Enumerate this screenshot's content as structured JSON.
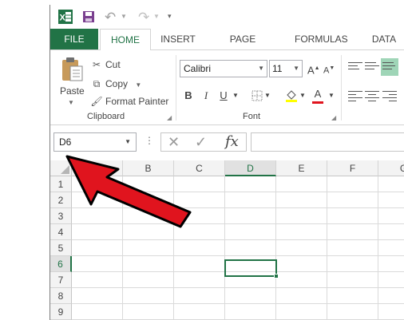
{
  "qat": {
    "app_icon": "excel-logo-icon",
    "save_icon": "save-icon",
    "undo_icon": "undo-icon",
    "redo_icon": "redo-icon",
    "customize_icon": "customize-qat-icon"
  },
  "tabs": {
    "file": "FILE",
    "home": "HOME",
    "insert": "INSERT",
    "page_layout": "PAGE LAYOUT",
    "formulas": "FORMULAS",
    "data": "DATA"
  },
  "clipboard": {
    "paste": "Paste",
    "cut": "Cut",
    "copy": "Copy",
    "format_painter": "Format Painter",
    "group_label": "Clipboard"
  },
  "font": {
    "name": "Calibri",
    "size": "11",
    "bold": "B",
    "italic": "I",
    "underline": "U",
    "group_label": "Font"
  },
  "formula_bar": {
    "name_box": "D6",
    "fx": "fx",
    "formula": ""
  },
  "grid": {
    "columns": [
      "A",
      "B",
      "C",
      "D",
      "E",
      "F",
      "G"
    ],
    "rows": [
      "1",
      "2",
      "3",
      "4",
      "5",
      "6",
      "7",
      "8",
      "9"
    ],
    "active_cell": "D6",
    "accent": "#217346"
  },
  "annotation": {
    "arrow_color": "#e0141e",
    "points_to": "select-all-button"
  }
}
